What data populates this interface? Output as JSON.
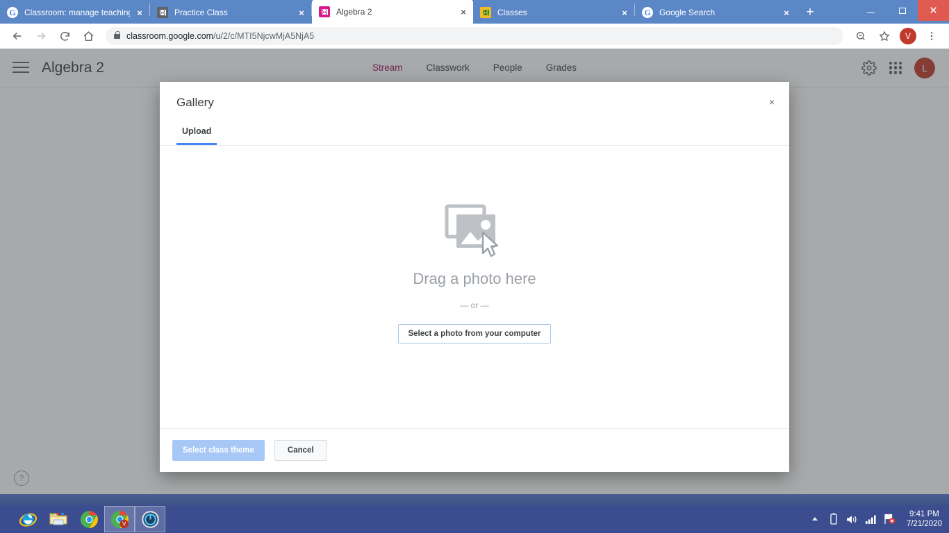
{
  "browser": {
    "tabs": [
      {
        "title": "Classroom: manage teaching an",
        "favicon": "google-icon",
        "active": false
      },
      {
        "title": "Practice Class",
        "favicon": "classroom-gray-icon",
        "active": false
      },
      {
        "title": "Algebra 2",
        "favicon": "classroom-pink-icon",
        "active": true
      },
      {
        "title": "Classes",
        "favicon": "classroom-yellow-icon",
        "active": false
      },
      {
        "title": "Google Search",
        "favicon": "google-icon",
        "active": false
      }
    ],
    "new_tab_label": "+",
    "close_label": "×",
    "window": {
      "minimize": "",
      "maximize": "",
      "close": "✕"
    },
    "toolbar": {
      "back": "←",
      "forward": "→",
      "reload": "⟳",
      "home": "⌂",
      "url_host": "classroom.google.com",
      "url_path": "/u/2/c/MTI5NjcwMjA5NjA5",
      "zoom_icon": "zoom-out-icon",
      "bookmark_icon": "star-icon",
      "profile_initial": "V",
      "menu_icon": "three-dot-menu-icon"
    }
  },
  "classroom": {
    "class_title": "Algebra 2",
    "nav": [
      {
        "label": "Stream",
        "active": true
      },
      {
        "label": "Classwork",
        "active": false
      },
      {
        "label": "People",
        "active": false
      },
      {
        "label": "Grades",
        "active": false
      }
    ],
    "active_nav_color": "#a01060",
    "settings_icon": "gear-icon",
    "apps_icon": "apps-grid-icon",
    "account_initial": "L",
    "help_label": "?"
  },
  "dialog": {
    "title": "Gallery",
    "close_label": "×",
    "tabs": [
      {
        "label": "Upload",
        "active": true
      }
    ],
    "accent_color": "#4285f4",
    "dropzone": {
      "icon": "photo-library-icon",
      "cursor_icon": "cursor-arrow-icon",
      "drag_text": "Drag a photo here",
      "or_text": "— or —",
      "select_button": "Select a photo from your computer"
    },
    "footer": {
      "primary_label": "Select class theme",
      "primary_disabled": true,
      "cancel_label": "Cancel"
    }
  },
  "taskbar": {
    "apps": [
      {
        "name": "internet-explorer",
        "active": false
      },
      {
        "name": "file-explorer",
        "active": false
      },
      {
        "name": "chrome",
        "active": false
      },
      {
        "name": "chrome-profile-v",
        "active": true
      },
      {
        "name": "media-player",
        "active": false
      }
    ],
    "tray": {
      "show_hidden": "▲",
      "battery_icon": "battery-icon",
      "volume_icon": "speaker-icon",
      "network_icon": "signal-bars-icon",
      "action_center_icon": "flag-error-icon",
      "time": "9:41 PM",
      "date": "7/21/2020"
    }
  }
}
